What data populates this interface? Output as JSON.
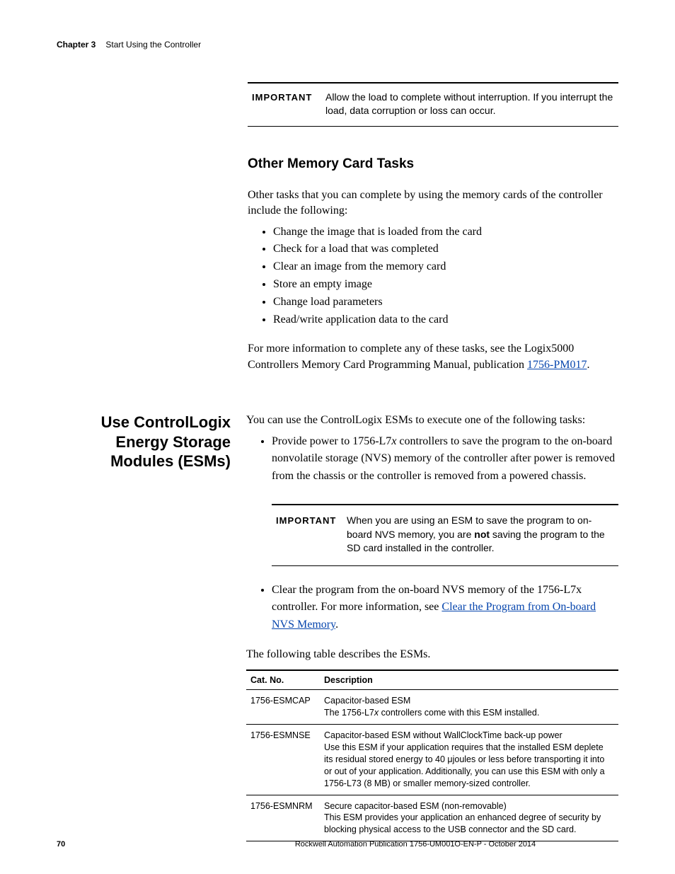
{
  "header": {
    "chapter": "Chapter 3",
    "title": "Start Using the Controller"
  },
  "callout1": {
    "label": "IMPORTANT",
    "text": "Allow the load to complete without interruption. If you interrupt the load, data corruption or loss can occur."
  },
  "section_memory": {
    "heading": "Other Memory Card Tasks",
    "intro": "Other tasks that you can complete by using the memory cards of the controller include the following:",
    "items": [
      "Change the image that is loaded from the card",
      "Check for a load that was completed",
      "Clear an image from the memory card",
      "Store an empty image",
      "Change load parameters",
      "Read/write application data to the card"
    ],
    "outro_pre": "For more information to complete any of these tasks, see the Logix5000 Controllers Memory Card Programming Manual, publication ",
    "outro_link": "1756-PM017",
    "outro_post": "."
  },
  "section_esm": {
    "side_heading": "Use ControlLogix Energy Storage Modules (ESMs)",
    "intro": "You can use the ControlLogix ESMs to execute one of the following tasks:",
    "bullet1_pre": "Provide power to 1756-L7",
    "bullet1_italic": "x",
    "bullet1_post": " controllers to save the program to the on-board nonvolatile storage (NVS) memory of the controller after power is removed from the chassis or the controller is removed from a powered chassis.",
    "callout": {
      "label": "IMPORTANT",
      "pre": "When you are using an ESM to save the program to on-board NVS memory, you are ",
      "bold": "not",
      "post": " saving the program to the SD card installed in the controller."
    },
    "bullet2_pre": "Clear the program from the on-board NVS memory of the 1756-L7x controller. For more information, see ",
    "bullet2_link": "Clear the Program from On-board NVS Memory",
    "bullet2_post": ".",
    "table_intro": "The following table describes the ESMs.",
    "table": {
      "headers": {
        "cat": "Cat. No.",
        "desc": "Description"
      },
      "rows": [
        {
          "cat": "1756-ESMCAP",
          "line1": "Capacitor-based ESM",
          "line2_pre": "The 1756-L7",
          "line2_italic": "x",
          "line2_post": " controllers come with this ESM installed."
        },
        {
          "cat": "1756-ESMNSE",
          "line1": "Capacitor-based ESM without WallClockTime back-up power",
          "line2": "Use this ESM if your application requires that the installed ESM deplete its residual stored energy to 40 μjoules or less before transporting it into or out of your application. Additionally, you can use this ESM with only a 1756-L73 (8 MB) or smaller memory-sized controller."
        },
        {
          "cat": "1756-ESMNRM",
          "line1": "Secure capacitor-based ESM (non-removable)",
          "line2": "This ESM provides your application an enhanced degree of security by blocking physical access to the USB connector and the SD card."
        }
      ]
    }
  },
  "footer": {
    "page": "70",
    "publication": "Rockwell Automation Publication 1756-UM001O-EN-P - October 2014"
  }
}
